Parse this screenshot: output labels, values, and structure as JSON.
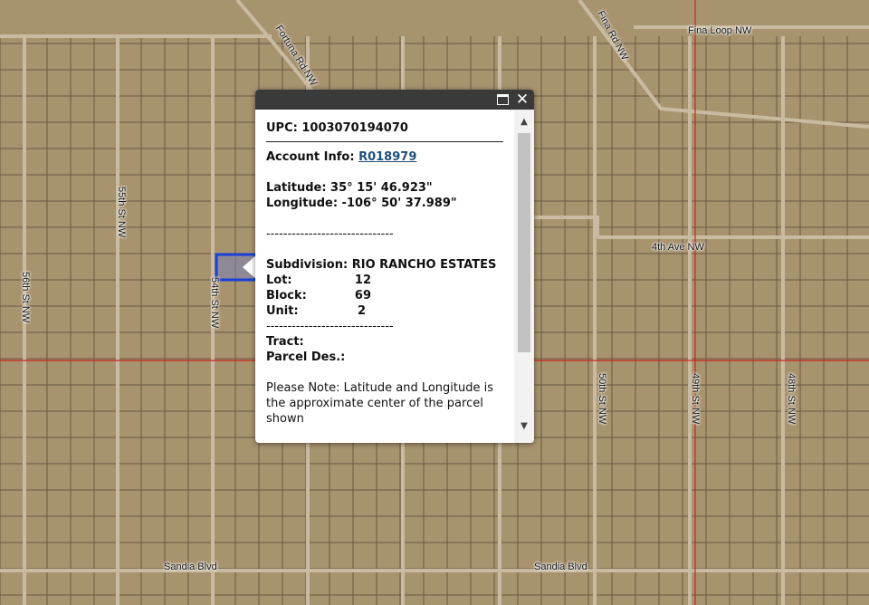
{
  "map": {
    "roads": {
      "fortuna": "Fortuna Rd NW",
      "fina_rd": "Fina Rd NW",
      "fina_loop": "Fina Loop NW",
      "st55": "55th St NW",
      "st56": "56th St NW",
      "st54": "54th St NW",
      "ave4": "4th Ave NW",
      "st50": "50th St NW",
      "st49": "49th St NW",
      "st48": "48th St NW",
      "sandia_w": "Sandia Blvd",
      "sandia_e": "Sandia Blvd"
    },
    "colors": {
      "terrain": "#a8936f",
      "parcel_line": "#5a4a38",
      "road": "#c9bba1",
      "boundary": "#d22020",
      "selected_parcel": "#1a3fd6"
    }
  },
  "popup": {
    "upc": "UPC: 1003070194070",
    "account_label": "Account Info:",
    "account_link": "R018979",
    "latitude": "Latitude: 35° 15' 46.923\"",
    "longitude": "Longitude: -106° 50' 37.989\"",
    "separator": "------------------------------",
    "subdivision_label": "Subdivision:",
    "subdivision_value": "RIO RANCHO ESTATES",
    "lot_label": "Lot:",
    "lot_value": "12",
    "block_label": "Block:",
    "block_value": "69",
    "unit_label": "Unit:",
    "unit_value": "2",
    "tract_label": "Tract:",
    "parcel_des_label": "Parcel Des.:",
    "note": "Please Note: Latitude and Longitude is the approximate center of the parcel shown",
    "icons": {
      "maximize": "maximize-icon",
      "close": "close-icon"
    }
  }
}
